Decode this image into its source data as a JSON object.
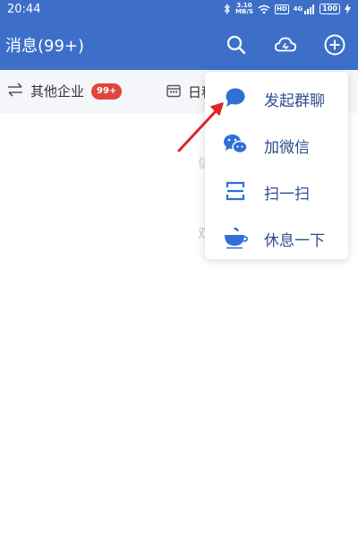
{
  "status_bar": {
    "time": "20:44",
    "speed_value": "3.10",
    "speed_unit": "MB/S",
    "hd_label": "HD",
    "network_label": "4G",
    "battery": "100"
  },
  "header": {
    "title": "消息(99+)",
    "icons": [
      "search-icon",
      "cloud-icon",
      "add-icon"
    ]
  },
  "subbar": {
    "switch_label": "其他企业",
    "badge": "99+",
    "calendar_label": "日程"
  },
  "background_hints": {
    "hint_1": "信",
    "hint_2": "双"
  },
  "popup_menu": {
    "items": [
      {
        "label": "发起群聊",
        "icon": "chat-bubble-icon"
      },
      {
        "label": "加微信",
        "icon": "wechat-icon"
      },
      {
        "label": "扫一扫",
        "icon": "scan-icon"
      },
      {
        "label": "休息一下",
        "icon": "teacup-icon"
      }
    ]
  },
  "colors": {
    "header_bg": "#3d6fc9",
    "subbar_bg": "#f4f6f9",
    "badge_bg": "#e1453a",
    "menu_icon": "#2f6fd6",
    "annotation_arrow": "#e02525"
  }
}
